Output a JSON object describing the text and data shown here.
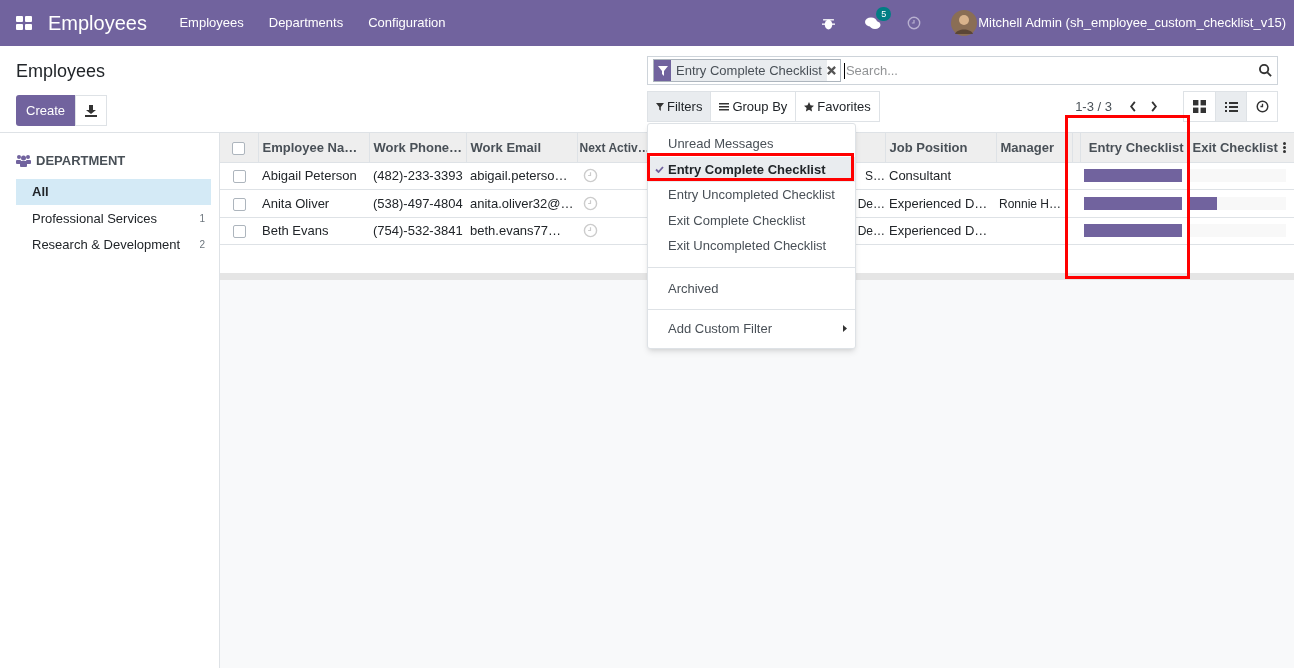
{
  "navbar": {
    "app_title": "Employees",
    "menu": [
      "Employees",
      "Departments",
      "Configuration"
    ],
    "messages_badge": "5",
    "user": "Mitchell Admin (sh_employee_custom_checklist_v15)"
  },
  "control_panel": {
    "title": "Employees",
    "create": "Create",
    "search": {
      "facet": "Entry Complete Checklist",
      "placeholder": "Search..."
    },
    "buttons": [
      "Filters",
      "Group By",
      "Favorites"
    ],
    "pager": "1-3 / 3",
    "views": [
      {
        "kind": "kanban",
        "selected": false
      },
      {
        "kind": "list",
        "selected": true
      },
      {
        "kind": "activity",
        "selected": false
      }
    ]
  },
  "filters_menu": {
    "groups": [
      [
        {
          "label": "Unread Messages",
          "checked": false
        },
        {
          "label": "Entry Complete Checklist",
          "checked": true
        },
        {
          "label": "Entry Uncompleted Checklist",
          "checked": false
        },
        {
          "label": "Exit Complete Checklist",
          "checked": false
        },
        {
          "label": "Exit Uncompleted Checklist",
          "checked": false
        }
      ],
      [
        {
          "label": "Archived",
          "checked": false
        }
      ]
    ],
    "custom": "Add Custom Filter"
  },
  "sidebar": {
    "heading": "DEPARTMENT",
    "items": [
      {
        "label": "All",
        "selected": true
      },
      {
        "label": "Professional Services",
        "count": "1",
        "selected": false
      },
      {
        "label": "Research & Development",
        "count": "2",
        "selected": false
      }
    ]
  },
  "table": {
    "select_all": {
      "checked": false
    },
    "columns": [
      "Employee Na…",
      "Work Phone…",
      "Work Email",
      "Next Activ…",
      "",
      "Job Position",
      "Manager",
      "Entry Checklist",
      "Exit Checklist"
    ],
    "rows": [
      {
        "checked": false,
        "name": "Abigail Peterson",
        "phone": "(482)-233-3393",
        "email": "abigail.peterso…",
        "column_5": "S…",
        "job": "Consultant",
        "entry_checklist": {
          "level": 1
        },
        "exit_checklist": {
          "level": 0
        }
      },
      {
        "checked": false,
        "name": "Anita Oliver",
        "phone": "(538)-497-4804",
        "email": "anita.oliver32@…",
        "column_5": "De…",
        "job": "Experienced D…",
        "manager": "Ronnie H…",
        "entry_checklist": {
          "level": 1
        },
        "exit_checklist": {
          "level": 0.3
        }
      },
      {
        "checked": false,
        "name": "Beth Evans",
        "phone": "(754)-532-3841",
        "email": "beth.evans77…",
        "column_5": "De…",
        "job": "Experienced D…",
        "entry_checklist": {
          "level": 1
        },
        "exit_checklist": {
          "level": 0
        }
      }
    ]
  }
}
